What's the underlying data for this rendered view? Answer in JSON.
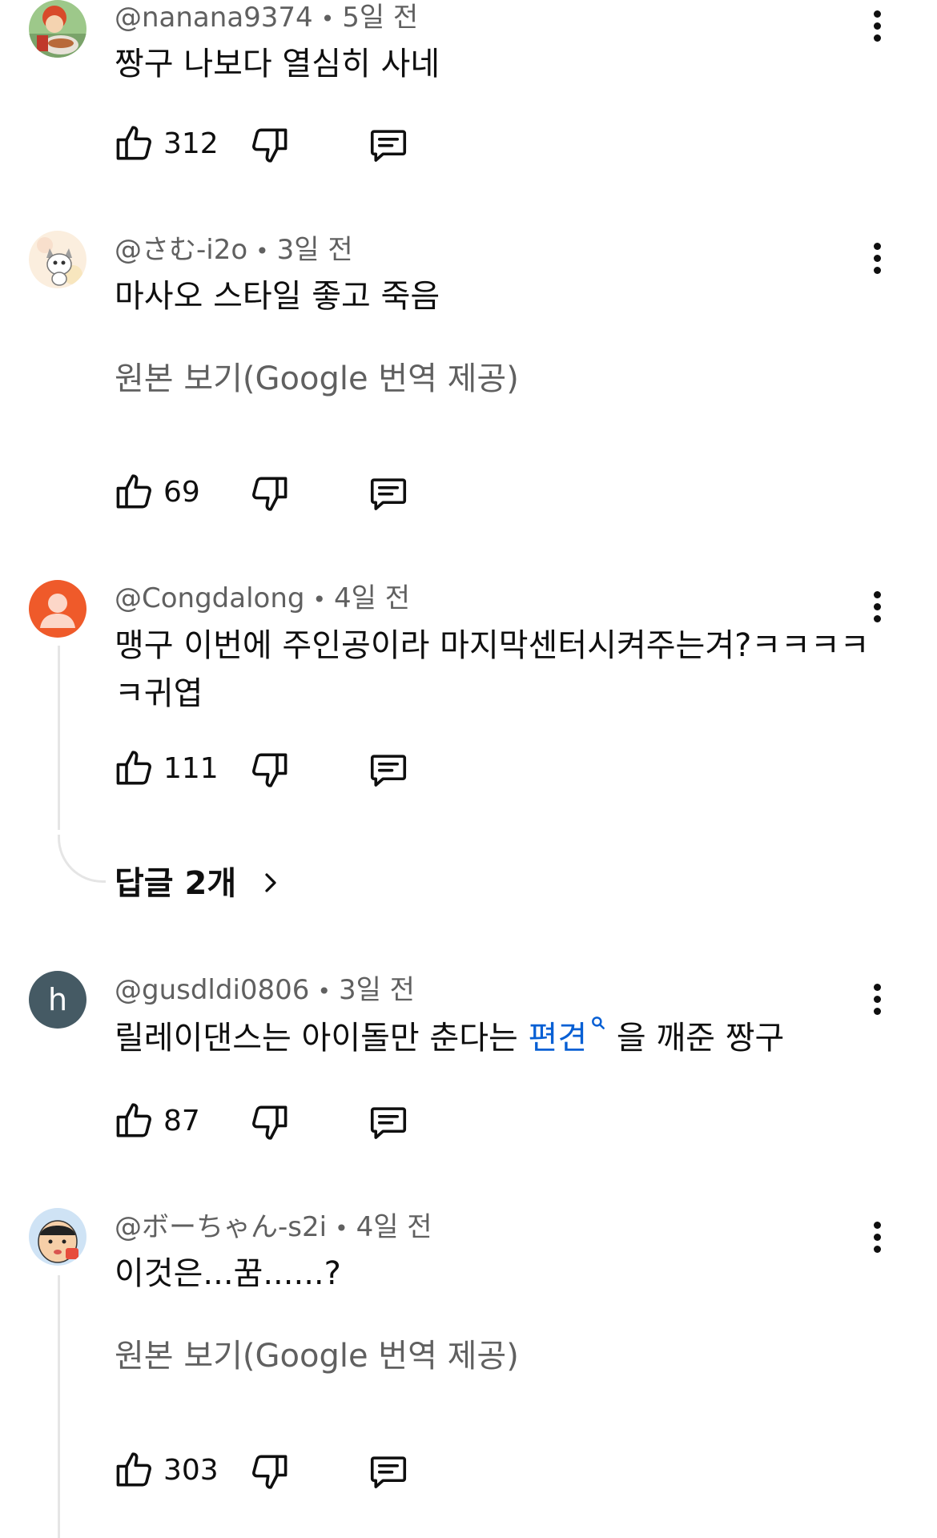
{
  "colors": {
    "text_primary": "#0f0f0f",
    "text_secondary": "#606060",
    "link": "#065fd4",
    "thread_line": "#e5e5e5",
    "avatar_congdalong": "#ef5a2a",
    "avatar_gusdldi": "#455a64"
  },
  "comments": [
    {
      "author": "@nanana9374",
      "separator": "•",
      "time": "5일 전",
      "text": "짱구 나보다 열심히 사네",
      "likes": "312",
      "avatar_icon": "anime-character-avatar"
    },
    {
      "author": "@さむ-i2o",
      "separator": "•",
      "time": "3일 전",
      "text": "마사오 스타일 좋고 죽음",
      "translate_label": "원본 보기(Google 번역 제공)",
      "likes": "69",
      "avatar_icon": "cat-avatar"
    },
    {
      "author": "@Congdalong",
      "separator": "•",
      "time": "4일 전",
      "text_line1": "맹구 이번에 주인공이라 마지막센터시켜주는겨?ㅋㅋㅋㅋ",
      "text_line2": "ㅋ귀엽",
      "likes": "111",
      "replies_label": "답글 2개",
      "avatar_icon": "default-person-avatar"
    },
    {
      "author": "@gusdldi0806",
      "separator": "•",
      "time": "3일 전",
      "text_before": "릴레이댄스는 아이돌만 춘다는 ",
      "text_link": "편견",
      "text_after": " 을 깨준 짱구",
      "likes": "87",
      "avatar_letter": "h"
    },
    {
      "author": "@ボーちゃん-s2i",
      "separator": "•",
      "time": "4일 전",
      "text": "이것은...꿈......?",
      "translate_label": "원본 보기(Google 번역 제공)",
      "likes": "303",
      "avatar_icon": "cartoon-face-avatar"
    }
  ]
}
